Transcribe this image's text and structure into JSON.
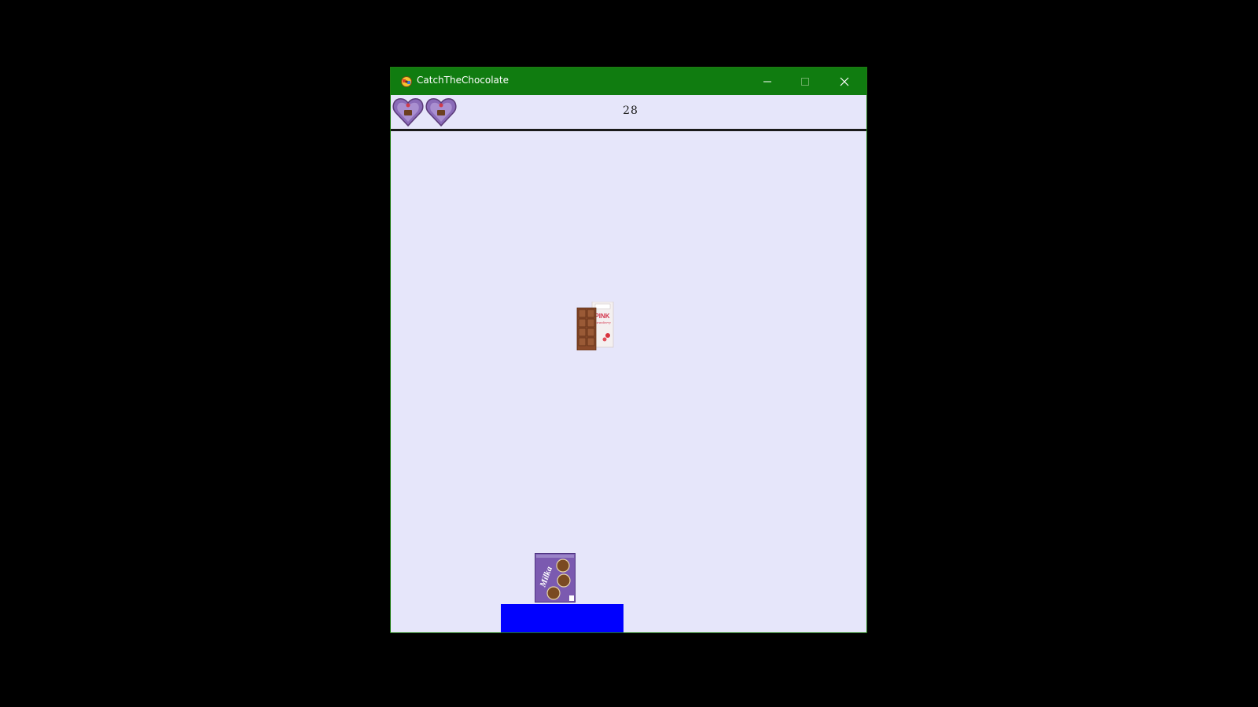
{
  "window": {
    "title": "CatchTheChocolate",
    "titlebar_color": "#107c10",
    "background_color": "#e6e6fa",
    "controls": {
      "minimize_icon": "minimize-icon",
      "maximize_icon": "maximize-icon",
      "close_icon": "close-icon"
    }
  },
  "hud": {
    "lives_icons": [
      "heart-chocolate-icon",
      "heart-chocolate-icon"
    ],
    "score": "28"
  },
  "game": {
    "falling_item": "pink-strawberry-chocolate-bar",
    "falling_item_label": "PINK",
    "caught_item": "milka-chocolate-bar",
    "caught_item_label": "Milka",
    "basket_color": "#0000ff"
  }
}
